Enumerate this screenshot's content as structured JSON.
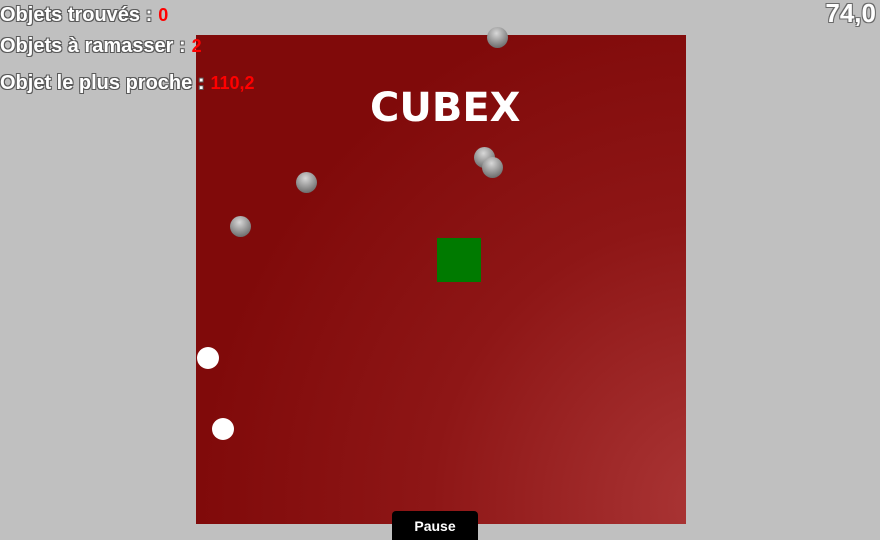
{
  "hud": {
    "found_label": "Objets trouvés :",
    "found_value": "0",
    "to_collect_label": "Objets à ramasser :",
    "to_collect_value": "2",
    "nearest_label": "Objet le plus proche :",
    "nearest_value": "110,2",
    "timer": "74,0"
  },
  "game": {
    "title": "CUBEX",
    "pause_label": "Pause"
  },
  "colors": {
    "background": "#c0c0c0",
    "board": "#8e1616",
    "player": "#007a00",
    "value_text": "#ff0000"
  }
}
